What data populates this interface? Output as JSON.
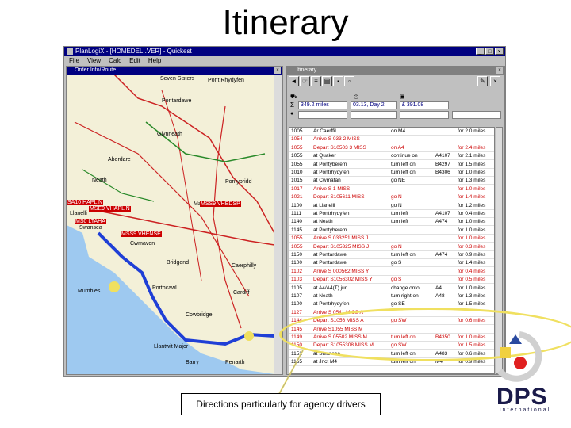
{
  "slide": {
    "title": "Itinerary",
    "callout": "Directions particularly for agency drivers"
  },
  "app": {
    "title": "PlanLogiX - [HOMEDELI.VER] - Quickest",
    "menu": [
      "File",
      "View",
      "Calc",
      "Edit",
      "Help"
    ]
  },
  "map_window": {
    "title": "Order Info/Route",
    "labels": [
      {
        "text": "Seven Sisters"
      },
      {
        "text": "Pont Rhydyfen"
      },
      {
        "text": "Pontardawe"
      },
      {
        "text": "Glynneath"
      },
      {
        "text": "Aberdare"
      },
      {
        "text": "Pontypridd"
      },
      {
        "text": "Neath"
      },
      {
        "text": "Swansea"
      },
      {
        "text": "Bridgend"
      },
      {
        "text": "Porthcawl"
      },
      {
        "text": "Caerphilly"
      },
      {
        "text": "Cardiff"
      },
      {
        "text": "Penarth"
      },
      {
        "text": "Barry"
      },
      {
        "text": "Cowbridge"
      },
      {
        "text": "Llantwit Major"
      },
      {
        "text": "Maesteg"
      },
      {
        "text": "Llanelli"
      },
      {
        "text": "Mumbles"
      },
      {
        "text": "Cwmavon"
      }
    ],
    "red_labels": [
      {
        "text": "SA10 HAPL N"
      },
      {
        "text": "MSE9 VHAPL N"
      },
      {
        "text": "MSS9 VHEDSP"
      },
      {
        "text": "MSS9 VHENSE"
      },
      {
        "text": "MS0 LTAHA"
      }
    ]
  },
  "itinerary": {
    "title": "Itinerary",
    "summary": {
      "distance": "349.2 miles",
      "duration": "03.13, Day 2",
      "cost": "£ 391.08"
    },
    "rows": [
      {
        "time": "1005",
        "desc": "Ar Caerffil",
        "road": "on M4",
        "cls": "",
        "dist": "for 2.0 miles"
      },
      {
        "time": "1054",
        "desc": "Arrive S 033 2 MISS",
        "road": "",
        "cls": "",
        "dist": "",
        "red": true
      },
      {
        "time": "1055",
        "desc": "Depart S10503 3 MISS",
        "road": "on A4",
        "cls": "",
        "dist": "for 2.4 miles",
        "red": true
      },
      {
        "time": "1055",
        "desc": "at Quaker",
        "road": "continue on",
        "cls": "A4107",
        "dist": "for 2.1 miles"
      },
      {
        "time": "1055",
        "desc": "at Pontyberem",
        "road": "turn left on",
        "cls": "B4297",
        "dist": "for 1.5 miles"
      },
      {
        "time": "1010",
        "desc": "at Pontrhydyfen",
        "road": "turn left on",
        "cls": "B4306",
        "dist": "for 1.0 miles"
      },
      {
        "time": "1015",
        "desc": "at Cwmafan",
        "road": "go NE",
        "cls": "",
        "dist": "for 1.3 miles"
      },
      {
        "time": "1017",
        "desc": "Arrive S 1 MISS",
        "road": "",
        "cls": "",
        "dist": "for 1.0 miles",
        "red": true
      },
      {
        "time": "1021",
        "desc": "Depart S105611 MISS",
        "road": "go N",
        "cls": "",
        "dist": "for 1.4 miles",
        "red": true
      },
      {
        "time": "1100",
        "desc": "at Llanelli",
        "road": "go N",
        "cls": "",
        "dist": "for 1.2 miles"
      },
      {
        "time": "1111",
        "desc": "at Pontrhydyfen",
        "road": "turn left",
        "cls": "A4107",
        "dist": "for 0.4 miles"
      },
      {
        "time": "1140",
        "desc": "at Neath",
        "road": "turn left",
        "cls": "A474",
        "dist": "for 1.0 miles"
      },
      {
        "time": "1145",
        "desc": "at Pontyberem",
        "road": "",
        "cls": "",
        "dist": "for 1.0 miles"
      },
      {
        "time": "1055",
        "desc": "Arrive S 033251 MISS J",
        "road": "",
        "cls": "",
        "dist": "for 1.0 miles",
        "red": true
      },
      {
        "time": "1055",
        "desc": "Depart S105325 MISS J",
        "road": "go N",
        "cls": "",
        "dist": "for 0.3 miles",
        "red": true
      },
      {
        "time": "1150",
        "desc": "at Pontardawe",
        "road": "turn left on",
        "cls": "A474",
        "dist": "for 0.9 miles"
      },
      {
        "time": "1100",
        "desc": "at Pontardawe",
        "road": "go S",
        "cls": "",
        "dist": "for 1.4 miles"
      },
      {
        "time": "1102",
        "desc": "Arrive S 000562 MISS Y",
        "road": "",
        "cls": "",
        "dist": "for 0.4 miles",
        "red": true
      },
      {
        "time": "1103",
        "desc": "Depart S1056302 MISS Y",
        "road": "go S",
        "cls": "",
        "dist": "for 0.5 miles",
        "red": true
      },
      {
        "time": "1105",
        "desc": "at A4/A4(T) jun",
        "road": "change onto",
        "cls": "A4",
        "dist": "for 1.0 miles"
      },
      {
        "time": "1107",
        "desc": "at Neath",
        "road": "turn right on",
        "cls": "A48",
        "dist": "for 1.3 miles"
      },
      {
        "time": "1100",
        "desc": "at Pontrhydyfen",
        "road": "go SE",
        "cls": "",
        "dist": "for 1.5 miles"
      },
      {
        "time": "1127",
        "desc": "Arrive S 0541 MISS A",
        "road": "",
        "cls": "",
        "dist": "",
        "red": true
      },
      {
        "time": "1144",
        "desc": "Depart S1056 MISS A",
        "road": "go SW",
        "cls": "",
        "dist": "for 0.6 miles",
        "red": true
      },
      {
        "time": "1145",
        "desc": "Arrive S1055 MISS M",
        "road": "",
        "cls": "",
        "dist": "",
        "red": true
      },
      {
        "time": "1149",
        "desc": "Arrive S 05502 MISS M",
        "road": "turn left on",
        "cls": "B4350",
        "dist": "for 1.0 miles",
        "red": true
      },
      {
        "time": "1150",
        "desc": "Depart S1055308 MISS M",
        "road": "go SW",
        "cls": "",
        "dist": "for 1.5 miles",
        "red": true
      },
      {
        "time": "1152",
        "desc": "at Swansea",
        "road": "turn left on",
        "cls": "A483",
        "dist": "for 0.6 miles"
      },
      {
        "time": "1155",
        "desc": "at Jnct M4",
        "road": "turn left on",
        "cls": "M4",
        "dist": "for 0.9 miles"
      }
    ]
  },
  "logo": {
    "text": "DPS",
    "sub": "international"
  },
  "colors": {
    "route": "#1f3fd6",
    "roads": "#cc2222",
    "sea": "#9ec9f0",
    "highlight": "#f0e060"
  }
}
